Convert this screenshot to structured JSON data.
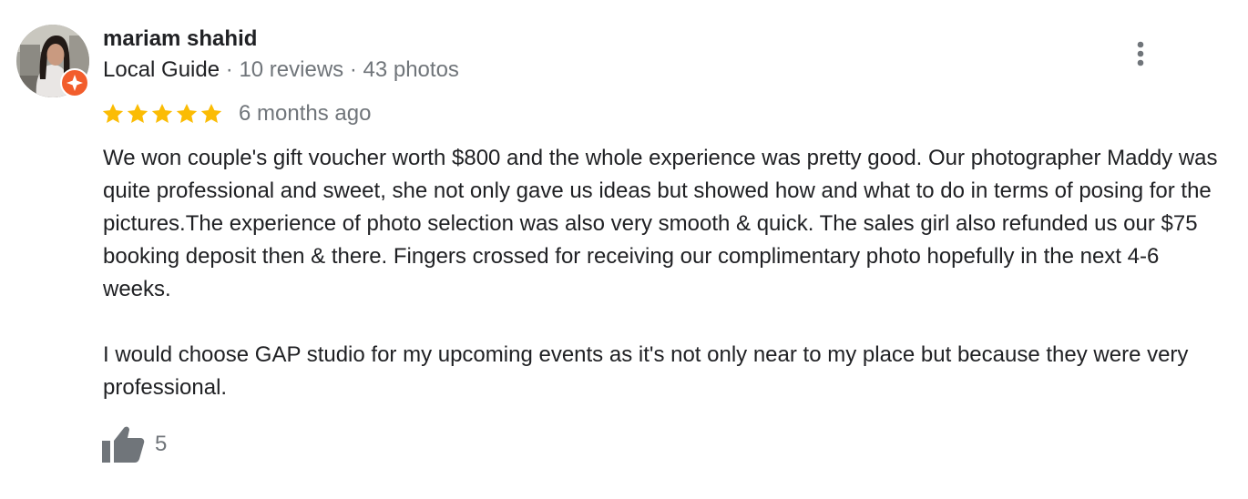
{
  "review": {
    "author": {
      "name": "mariam shahid",
      "badge": "Local Guide",
      "reviews": "10 reviews",
      "photos": "43 photos",
      "separator": "·"
    },
    "rating": {
      "value": 5,
      "max": 5,
      "star_color": "#fbbc04"
    },
    "date": "6 months ago",
    "body": [
      "We won couple's gift voucher worth $800 and the whole experience was pretty good. Our photographer Maddy was quite professional and sweet, she not only gave us ideas but showed how and what to do in terms of posing for the pictures.The experience of photo selection was also very smooth & quick. The sales girl also refunded us our $75 booking deposit then & there. Fingers crossed for receiving our complimentary photo hopefully in the next 4-6 weeks.",
      "I would choose GAP studio for my upcoming events as it's not only near to my place but because they were very professional."
    ],
    "likes": "5",
    "icons": {
      "more": "more-vert-icon",
      "like": "thumb-up-icon",
      "badge": "local-guide-badge-icon"
    },
    "colors": {
      "text": "#202124",
      "secondary": "#70757a",
      "badge": "#f25d2c",
      "icon": "#70757a"
    }
  }
}
